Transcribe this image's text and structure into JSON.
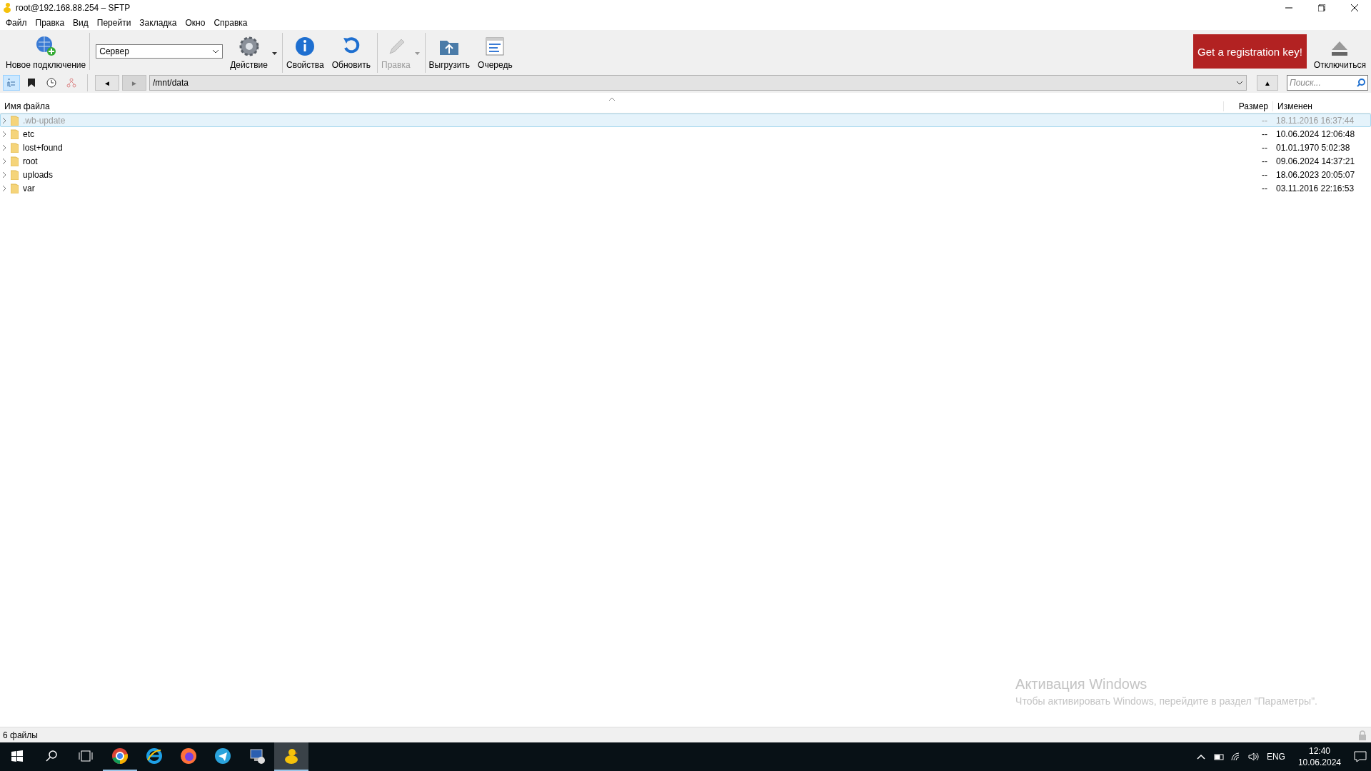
{
  "window": {
    "title": "root@192.168.88.254 – SFTP"
  },
  "menu": [
    "Файл",
    "Правка",
    "Вид",
    "Перейти",
    "Закладка",
    "Окно",
    "Справка"
  ],
  "toolbar": {
    "items": [
      {
        "kind": "button",
        "label": "Новое подключение",
        "disabled": false,
        "dropdown": false,
        "separator_before": false
      },
      {
        "kind": "combo",
        "value": "Сервер",
        "separator_before": true
      },
      {
        "kind": "button",
        "label": "Действие",
        "disabled": false,
        "dropdown": true,
        "separator_before": false
      },
      {
        "kind": "button",
        "label": "Свойства",
        "disabled": false,
        "dropdown": false,
        "separator_before": true
      },
      {
        "kind": "button",
        "label": "Обновить",
        "disabled": false,
        "dropdown": false,
        "separator_before": false
      },
      {
        "kind": "button",
        "label": "Правка",
        "disabled": true,
        "dropdown": true,
        "separator_before": true
      },
      {
        "kind": "button",
        "label": "Выгрузить",
        "disabled": false,
        "dropdown": false,
        "separator_before": true
      },
      {
        "kind": "button",
        "label": "Очередь",
        "disabled": false,
        "dropdown": false,
        "separator_before": false
      }
    ],
    "registration": "Get a registration key!",
    "disconnect": "Отключиться"
  },
  "navbar": {
    "views": [
      {
        "selected": true
      },
      {
        "selected": false
      },
      {
        "selected": false
      },
      {
        "selected": false
      }
    ],
    "back": {
      "label": "◄",
      "disabled": false
    },
    "forward": {
      "label": "►",
      "disabled": true
    },
    "path": "/mnt/data",
    "up": "▲",
    "search": {
      "placeholder": "Поиск..."
    }
  },
  "table": {
    "columns": [
      "Имя файла",
      "Размер",
      "Изменен"
    ],
    "rows": [
      {
        "name": ".wb-update",
        "size": "--",
        "modified": "18.11.2016 16:37:44",
        "hidden": true,
        "selected": true
      },
      {
        "name": "etc",
        "size": "--",
        "modified": "10.06.2024 12:06:48",
        "hidden": false,
        "selected": false
      },
      {
        "name": "lost+found",
        "size": "--",
        "modified": "01.01.1970 5:02:38",
        "hidden": false,
        "selected": false
      },
      {
        "name": "root",
        "size": "--",
        "modified": "09.06.2024 14:37:21",
        "hidden": false,
        "selected": false
      },
      {
        "name": "uploads",
        "size": "--",
        "modified": "18.06.2023 20:05:07",
        "hidden": false,
        "selected": false
      },
      {
        "name": "var",
        "size": "--",
        "modified": "03.11.2016 22:16:53",
        "hidden": false,
        "selected": false
      }
    ]
  },
  "activation_notice": {
    "title": "Активация Windows",
    "text": "Чтобы активировать Windows, перейдите в раздел \"Параметры\"."
  },
  "status_bar": {
    "text": "6 файлы"
  },
  "taskbar": {
    "apps": [
      {
        "running": true,
        "active": false
      },
      {
        "running": false,
        "active": false
      },
      {
        "running": false,
        "active": false
      },
      {
        "running": false,
        "active": false
      },
      {
        "running": false,
        "active": false
      },
      {
        "running": true,
        "active": true
      }
    ],
    "language": "ENG",
    "time": "12:40",
    "date": "10.06.2024"
  }
}
